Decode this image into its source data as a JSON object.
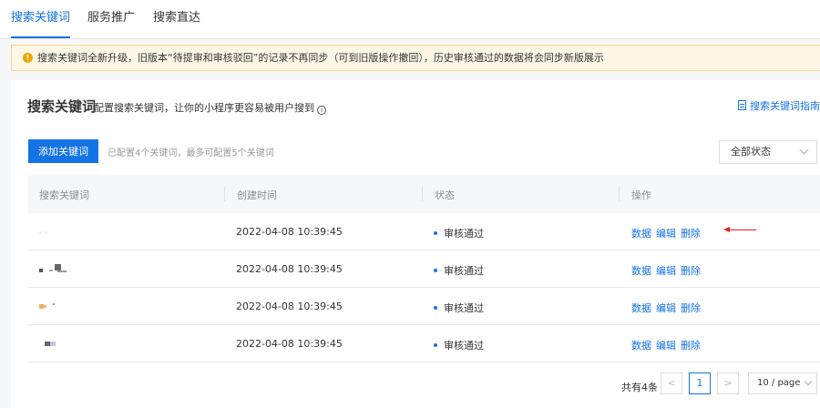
{
  "tabs": [
    {
      "label": "搜索关键词",
      "active": true
    },
    {
      "label": "服务推广",
      "active": false
    },
    {
      "label": "搜索直达",
      "active": false
    }
  ],
  "notice": {
    "icon": "warning-icon",
    "text": "搜索关键词全新升级，旧版本“待提审和审核驳回”的记录不再同步（可到旧版操作撤回），历史审核通过的数据将会同步新版展示"
  },
  "panel": {
    "title": "搜索关键词",
    "subtitle": "配置搜索关键词，让你的小程序更容易被用户搜到",
    "guide_link": "搜索关键词指南",
    "add_button": "添加关键词",
    "add_hint": "已配置4个关键词，最多可配置5个关键词",
    "status_filter": "全部状态"
  },
  "table": {
    "headers": [
      "搜索关键词",
      "创建时间",
      "状态",
      "操作"
    ],
    "rows": [
      {
        "keyword": "",
        "created": "2022-04-08 10:39:45",
        "status": "审核通过",
        "actions": [
          "数据",
          "编辑",
          "删除"
        ]
      },
      {
        "keyword": "",
        "created": "2022-04-08 10:39:45",
        "status": "审核通过",
        "actions": [
          "数据",
          "编辑",
          "删除"
        ]
      },
      {
        "keyword": "",
        "created": "2022-04-08 10:39:45",
        "status": "审核通过",
        "actions": [
          "数据",
          "编辑",
          "删除"
        ]
      },
      {
        "keyword": "",
        "created": "2022-04-08 10:39:45",
        "status": "审核通过",
        "actions": [
          "数据",
          "编辑",
          "删除"
        ]
      }
    ]
  },
  "pagination": {
    "total": "共有4条",
    "current_page": "1",
    "page_size": "10 / page"
  },
  "colors": {
    "accent": "#1473e6",
    "notice_bg": "#fff7e6",
    "annotation_arrow": "#e02020"
  }
}
